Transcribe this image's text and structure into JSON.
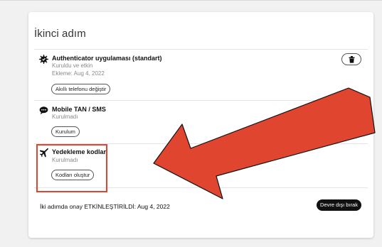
{
  "card": {
    "title": "İkinci adım"
  },
  "methods": [
    {
      "icon": "gear-shield-icon",
      "title": "Authenticator uygulaması (standart)",
      "status": "Kuruldu ve etkin",
      "added": "Ekleme: Aug 4, 2022",
      "button": "Akıllı telefonu değiştir"
    },
    {
      "icon": "chat-bubble-icon",
      "title": "Mobile TAN / SMS",
      "status": "Kurulmadı",
      "button": "Kurulum"
    },
    {
      "icon": "airplane-icon",
      "title": "Yedekleme kodları",
      "status": "Kurulmadı",
      "button": "Kodları oluştur"
    }
  ],
  "footer": {
    "text": "İki adımda onay ETKİNLEŞTİRİLDİ: Aug 4, 2022",
    "button": "Devre dışı bırak"
  },
  "annotation": {
    "color": "#e0462f"
  }
}
